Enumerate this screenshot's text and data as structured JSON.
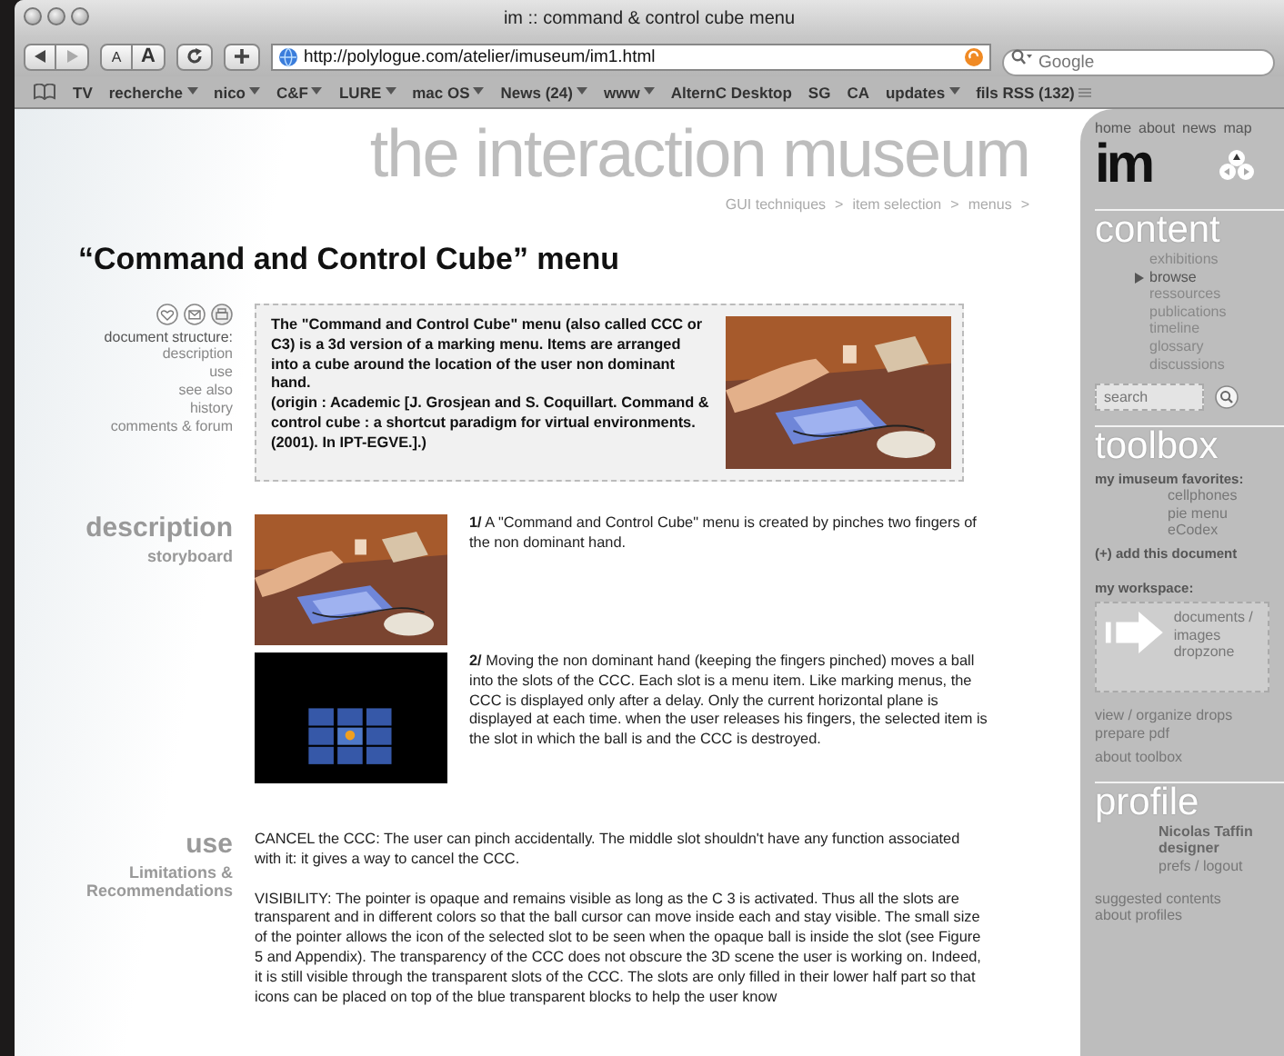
{
  "window": {
    "title": "im :: command & control cube menu"
  },
  "toolbar": {
    "text_size": [
      "A",
      "A"
    ],
    "url": "http://polylogue.com/atelier/imuseum/im1.html",
    "search_placeholder": "Google"
  },
  "bookmarks": [
    {
      "label": "TV",
      "kind": "link"
    },
    {
      "label": "recherche",
      "kind": "menu"
    },
    {
      "label": "nico",
      "kind": "menu"
    },
    {
      "label": "C&F",
      "kind": "menu"
    },
    {
      "label": "LURE",
      "kind": "menu"
    },
    {
      "label": "mac OS",
      "kind": "menu"
    },
    {
      "label": "News (24)",
      "kind": "menu"
    },
    {
      "label": "www",
      "kind": "menu"
    },
    {
      "label": "AlternC Desktop",
      "kind": "link"
    },
    {
      "label": "SG",
      "kind": "link"
    },
    {
      "label": "CA",
      "kind": "link"
    },
    {
      "label": "updates",
      "kind": "menu"
    },
    {
      "label": "fils RSS (132)",
      "kind": "tabs"
    }
  ],
  "header": {
    "site_title": "the interaction museum",
    "breadcrumbs": [
      "GUI techniques",
      "item selection",
      "menus"
    ],
    "separator": ">"
  },
  "page_title": "“Command and Control Cube” menu",
  "document_structure": {
    "label": "document structure:",
    "links": [
      "description",
      "use",
      "see also",
      "history",
      "comments & forum"
    ]
  },
  "intro": [
    "The \"Command and Control Cube\" menu (also called CCC or C3) is a 3d version of a marking menu.  Items are arranged into a cube around the location of the user non dominant hand.",
    "(origin : Academic  [J. Grosjean and S. Coquillart. Command & control cube : a shortcut paradigm for virtual environments. (2001). In IPT-EGVE.].)"
  ],
  "description": {
    "heading": "description",
    "subheading": "storyboard",
    "steps": [
      {
        "text": "**1/** A \"Command and Control Cube\" menu is created by pinches two fingers of the non dominant hand."
      },
      {
        "kind": "render",
        "text": "**2/** Moving the non dominant hand (keeping the fingers pinched) moves a ball into the slots of the CCC. Each slot is a menu item.  Like marking menus, the CCC is displayed only after a delay. Only the current horizontal plane is displayed at each time.  when the user releases his fingers, the selected item is the slot in which the ball is and the CCC is destroyed."
      }
    ]
  },
  "use": {
    "heading": "use",
    "subheading": "Limitations & Recommendations",
    "paragraphs": [
      "CANCEL the CCC: The user can pinch accidentally. The middle slot shouldn't have any function associated with it: it gives a way to cancel the CCC.",
      "VISIBILITY: The pointer is opaque and remains visible as long as the C 3 is activated. Thus all the slots are transparent and in different colors so that the ball cursor can move inside each and stay visible. The small size of the pointer allows the icon of the selected slot to be seen when the opaque ball is inside the slot (see Figure 5 and Appendix). The transparency of the CCC does not obscure the 3D scene the user is working on. Indeed, it is still visible through the transparent slots of the CCC. The slots are only filled in their lower half part so that icons can be placed on top of the blue transparent blocks to help the user know"
    ]
  },
  "sidebar": {
    "nav": [
      "home",
      "about",
      "news",
      "map"
    ],
    "logo": "im",
    "content": {
      "heading": "content",
      "items": [
        {
          "label": "exhibitions",
          "selected": false
        },
        {
          "label": "browse",
          "selected": true
        },
        {
          "label": "ressources",
          "selected": false
        },
        {
          "label": "publications",
          "selected": false
        },
        {
          "label": "timeline",
          "selected": false
        },
        {
          "label": "glossary",
          "selected": false
        },
        {
          "label": "discussions",
          "selected": false
        }
      ],
      "search_placeholder": "search"
    },
    "toolbox": {
      "heading": "toolbox",
      "favorites_label": "my imuseum favorites:",
      "favorites": [
        "cellphones",
        "pie menu",
        "eCodex"
      ],
      "add": "(+) add this document",
      "workspace_label": "my workspace:",
      "dropzone": "documents / images dropzone",
      "links": [
        "view / organize drops",
        "prepare pdf"
      ],
      "about": "about toolbox"
    },
    "profile": {
      "heading": "profile",
      "name": "Nicolas Taffin",
      "role": "designer",
      "account": "prefs / logout",
      "links": [
        "suggested contents",
        "about profiles"
      ]
    }
  }
}
